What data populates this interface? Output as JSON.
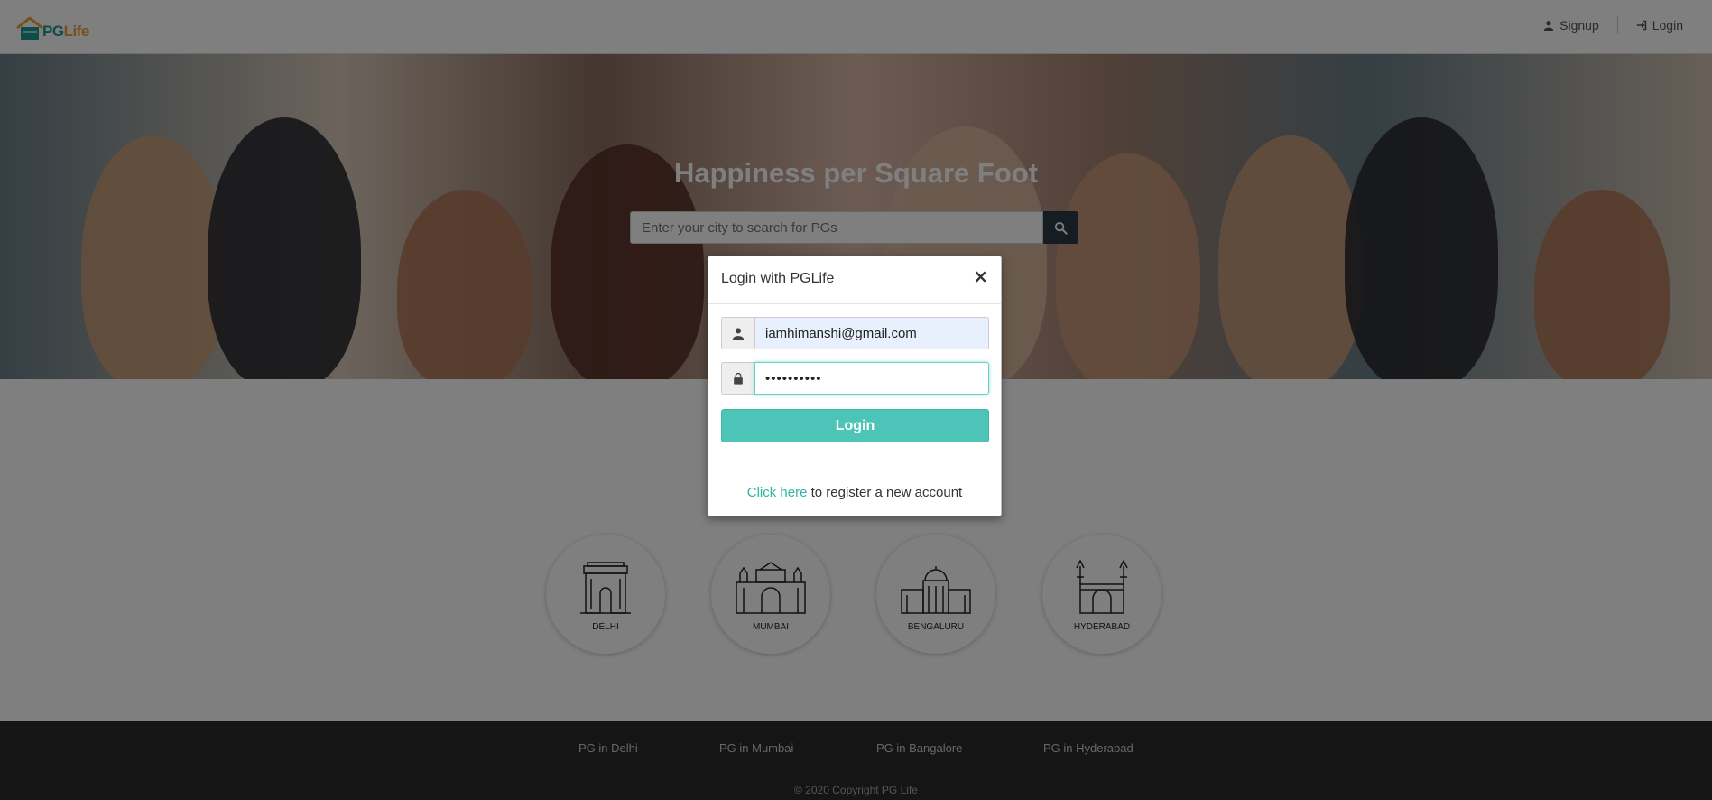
{
  "header": {
    "logo_pg": "PG",
    "logo_life": "Life",
    "signup_label": "Signup",
    "login_label": "Login"
  },
  "banner": {
    "title": "Happiness per Square Foot",
    "search_placeholder": "Enter your city to search for PGs"
  },
  "cities": [
    {
      "name": "DELHI"
    },
    {
      "name": "MUMBAI"
    },
    {
      "name": "BENGALURU"
    },
    {
      "name": "HYDERABAD"
    }
  ],
  "footer": {
    "links": [
      "PG in Delhi",
      "PG in Mumbai",
      "PG in Bangalore",
      "PG in Hyderabad"
    ],
    "copyright": "© 2020 Copyright PG Life"
  },
  "modal": {
    "title": "Login with PGLife",
    "close": "×",
    "email_value": "iamhimanshi@gmail.com",
    "password_value": "••••••••••",
    "login_button": "Login",
    "register_link": "Click here",
    "register_text": " to register a new account"
  },
  "colors": {
    "accent": "#4dc4b8",
    "link": "#30b5a5",
    "footer_bg": "#2b2b2b",
    "search_button": "#2b3a47"
  },
  "icons": {
    "signup": "user-icon",
    "login": "sign-in-icon",
    "search": "search-icon",
    "email": "user-icon",
    "password": "lock-icon"
  }
}
